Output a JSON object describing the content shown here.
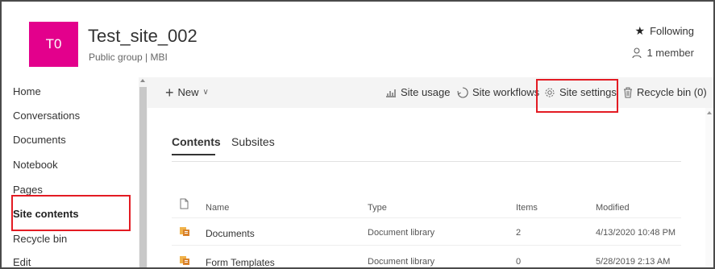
{
  "site": {
    "logo_text": "T0",
    "title": "Test_site_002",
    "subtitle": "Public group | MBI",
    "following": "Following",
    "members": "1 member"
  },
  "nav": {
    "items": [
      "Home",
      "Conversations",
      "Documents",
      "Notebook",
      "Pages",
      "Site contents",
      "Recycle bin",
      "Edit"
    ],
    "active": "Site contents"
  },
  "commands": {
    "new": "New",
    "site_usage": "Site usage",
    "site_workflows": "Site workflows",
    "site_settings": "Site settings",
    "recycle_bin": "Recycle bin (0)"
  },
  "tabs": [
    "Contents",
    "Subsites"
  ],
  "table": {
    "columns": {
      "name": "Name",
      "type": "Type",
      "items": "Items",
      "modified": "Modified"
    },
    "rows": [
      {
        "name": "Documents",
        "type": "Document library",
        "items": "2",
        "modified": "4/13/2020 10:48 PM"
      },
      {
        "name": "Form Templates",
        "type": "Document library",
        "items": "0",
        "modified": "5/28/2019 2:13 AM"
      }
    ]
  },
  "colors": {
    "logo": "#e3008c",
    "annotation": "#e31b23",
    "library_icon": "#d9822b"
  }
}
